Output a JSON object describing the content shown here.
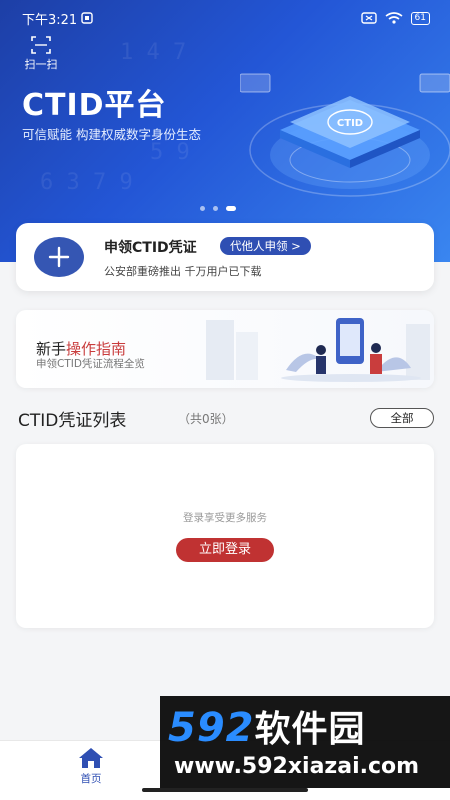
{
  "status": {
    "time": "下午3:21",
    "battery": "61"
  },
  "hero": {
    "scan_label": "扫一扫",
    "title": "CTID平台",
    "subtitle": "可信赋能 构建权威数字身份生态",
    "illus_logo": "CTID",
    "carousel_count": 3,
    "carousel_active": 2
  },
  "apply": {
    "title": "申领CTID凭证",
    "proxy_button": "代他人申领 >",
    "subtitle": "公安部重磅推出 千万用户已下载"
  },
  "guide": {
    "title_plain": "新手",
    "title_accent": "操作指南",
    "subtitle": "申领CTID凭证流程全览"
  },
  "list": {
    "title": "CTID凭证列表",
    "count": "（共0张）",
    "all_button": "全部"
  },
  "login_card": {
    "hint": "登录享受更多服务",
    "login_button": "立即登录"
  },
  "tabbar": {
    "home_label": "首页"
  },
  "watermark": {
    "logo_num": "592",
    "logo_cn": "软件园",
    "url": "www.592xiazai.com"
  },
  "colors": {
    "primary": "#2f4fb3",
    "accent_red": "#c03232",
    "hero_blue": "#2356d6"
  }
}
